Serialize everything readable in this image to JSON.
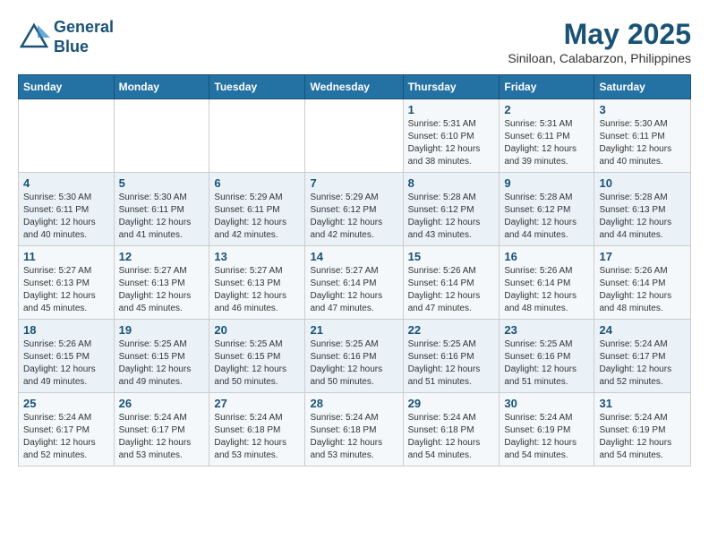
{
  "header": {
    "logo_line1": "General",
    "logo_line2": "Blue",
    "month": "May 2025",
    "location": "Siniloan, Calabarzon, Philippines"
  },
  "days_of_week": [
    "Sunday",
    "Monday",
    "Tuesday",
    "Wednesday",
    "Thursday",
    "Friday",
    "Saturday"
  ],
  "weeks": [
    [
      {
        "day": "",
        "info": ""
      },
      {
        "day": "",
        "info": ""
      },
      {
        "day": "",
        "info": ""
      },
      {
        "day": "",
        "info": ""
      },
      {
        "day": "1",
        "info": "Sunrise: 5:31 AM\nSunset: 6:10 PM\nDaylight: 12 hours\nand 38 minutes."
      },
      {
        "day": "2",
        "info": "Sunrise: 5:31 AM\nSunset: 6:11 PM\nDaylight: 12 hours\nand 39 minutes."
      },
      {
        "day": "3",
        "info": "Sunrise: 5:30 AM\nSunset: 6:11 PM\nDaylight: 12 hours\nand 40 minutes."
      }
    ],
    [
      {
        "day": "4",
        "info": "Sunrise: 5:30 AM\nSunset: 6:11 PM\nDaylight: 12 hours\nand 40 minutes."
      },
      {
        "day": "5",
        "info": "Sunrise: 5:30 AM\nSunset: 6:11 PM\nDaylight: 12 hours\nand 41 minutes."
      },
      {
        "day": "6",
        "info": "Sunrise: 5:29 AM\nSunset: 6:11 PM\nDaylight: 12 hours\nand 42 minutes."
      },
      {
        "day": "7",
        "info": "Sunrise: 5:29 AM\nSunset: 6:12 PM\nDaylight: 12 hours\nand 42 minutes."
      },
      {
        "day": "8",
        "info": "Sunrise: 5:28 AM\nSunset: 6:12 PM\nDaylight: 12 hours\nand 43 minutes."
      },
      {
        "day": "9",
        "info": "Sunrise: 5:28 AM\nSunset: 6:12 PM\nDaylight: 12 hours\nand 44 minutes."
      },
      {
        "day": "10",
        "info": "Sunrise: 5:28 AM\nSunset: 6:13 PM\nDaylight: 12 hours\nand 44 minutes."
      }
    ],
    [
      {
        "day": "11",
        "info": "Sunrise: 5:27 AM\nSunset: 6:13 PM\nDaylight: 12 hours\nand 45 minutes."
      },
      {
        "day": "12",
        "info": "Sunrise: 5:27 AM\nSunset: 6:13 PM\nDaylight: 12 hours\nand 45 minutes."
      },
      {
        "day": "13",
        "info": "Sunrise: 5:27 AM\nSunset: 6:13 PM\nDaylight: 12 hours\nand 46 minutes."
      },
      {
        "day": "14",
        "info": "Sunrise: 5:27 AM\nSunset: 6:14 PM\nDaylight: 12 hours\nand 47 minutes."
      },
      {
        "day": "15",
        "info": "Sunrise: 5:26 AM\nSunset: 6:14 PM\nDaylight: 12 hours\nand 47 minutes."
      },
      {
        "day": "16",
        "info": "Sunrise: 5:26 AM\nSunset: 6:14 PM\nDaylight: 12 hours\nand 48 minutes."
      },
      {
        "day": "17",
        "info": "Sunrise: 5:26 AM\nSunset: 6:14 PM\nDaylight: 12 hours\nand 48 minutes."
      }
    ],
    [
      {
        "day": "18",
        "info": "Sunrise: 5:26 AM\nSunset: 6:15 PM\nDaylight: 12 hours\nand 49 minutes."
      },
      {
        "day": "19",
        "info": "Sunrise: 5:25 AM\nSunset: 6:15 PM\nDaylight: 12 hours\nand 49 minutes."
      },
      {
        "day": "20",
        "info": "Sunrise: 5:25 AM\nSunset: 6:15 PM\nDaylight: 12 hours\nand 50 minutes."
      },
      {
        "day": "21",
        "info": "Sunrise: 5:25 AM\nSunset: 6:16 PM\nDaylight: 12 hours\nand 50 minutes."
      },
      {
        "day": "22",
        "info": "Sunrise: 5:25 AM\nSunset: 6:16 PM\nDaylight: 12 hours\nand 51 minutes."
      },
      {
        "day": "23",
        "info": "Sunrise: 5:25 AM\nSunset: 6:16 PM\nDaylight: 12 hours\nand 51 minutes."
      },
      {
        "day": "24",
        "info": "Sunrise: 5:24 AM\nSunset: 6:17 PM\nDaylight: 12 hours\nand 52 minutes."
      }
    ],
    [
      {
        "day": "25",
        "info": "Sunrise: 5:24 AM\nSunset: 6:17 PM\nDaylight: 12 hours\nand 52 minutes."
      },
      {
        "day": "26",
        "info": "Sunrise: 5:24 AM\nSunset: 6:17 PM\nDaylight: 12 hours\nand 53 minutes."
      },
      {
        "day": "27",
        "info": "Sunrise: 5:24 AM\nSunset: 6:18 PM\nDaylight: 12 hours\nand 53 minutes."
      },
      {
        "day": "28",
        "info": "Sunrise: 5:24 AM\nSunset: 6:18 PM\nDaylight: 12 hours\nand 53 minutes."
      },
      {
        "day": "29",
        "info": "Sunrise: 5:24 AM\nSunset: 6:18 PM\nDaylight: 12 hours\nand 54 minutes."
      },
      {
        "day": "30",
        "info": "Sunrise: 5:24 AM\nSunset: 6:19 PM\nDaylight: 12 hours\nand 54 minutes."
      },
      {
        "day": "31",
        "info": "Sunrise: 5:24 AM\nSunset: 6:19 PM\nDaylight: 12 hours\nand 54 minutes."
      }
    ]
  ]
}
